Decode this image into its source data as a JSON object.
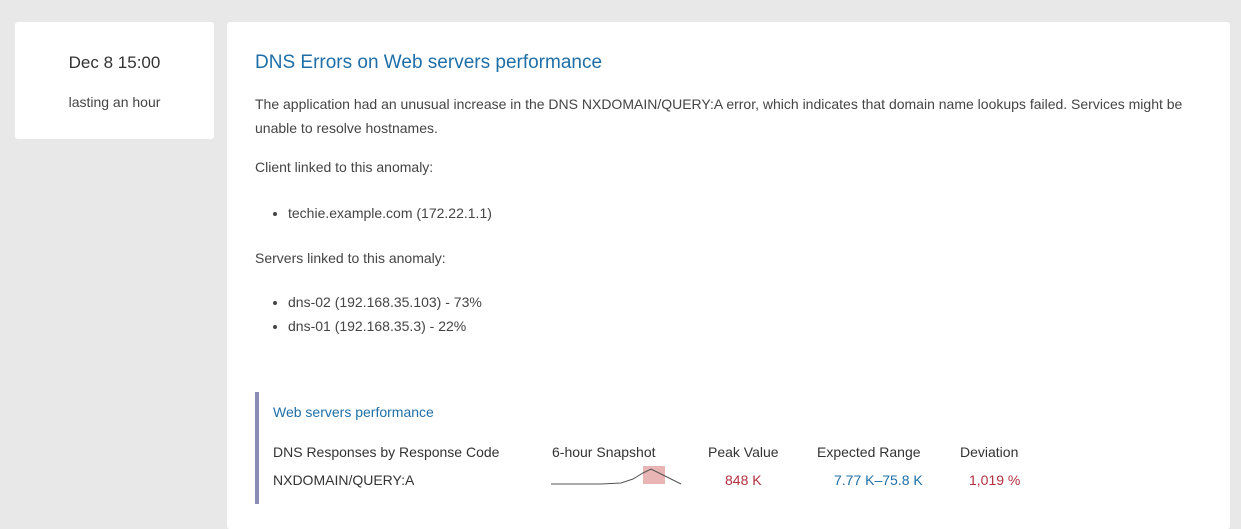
{
  "time": {
    "when": "Dec 8 15:00",
    "duration": "lasting an hour"
  },
  "anomaly": {
    "title": "DNS Errors on Web servers performance",
    "description": "The application had an unusual increase in the DNS NXDOMAIN/QUERY:A error, which indicates that domain name lookups failed. Services might be unable to resolve hostnames.",
    "client_label": "Client linked to this anomaly:",
    "clients": [
      "techie.example.com (172.22.1.1)"
    ],
    "servers_label": "Servers linked to this anomaly:",
    "servers": [
      "dns-02 (192.168.35.103) - 73%",
      "dns-01 (192.168.35.3) - 22%"
    ]
  },
  "panel": {
    "title": "Web servers performance",
    "headers": {
      "metric": "DNS Responses by Response Code",
      "snapshot": "6-hour Snapshot",
      "peak": "Peak Value",
      "expected": "Expected Range",
      "deviation": "Deviation"
    },
    "row": {
      "metric": "NXDOMAIN/QUERY:A",
      "peak": "848 K",
      "expected": "7.77 K–75.8 K",
      "deviation": "1,019 %"
    },
    "colors": {
      "link": "#1e6fa8",
      "alert": "#b3303f",
      "accent_bar": "#8b8bb5",
      "highlight": "#e8b4b4"
    }
  }
}
